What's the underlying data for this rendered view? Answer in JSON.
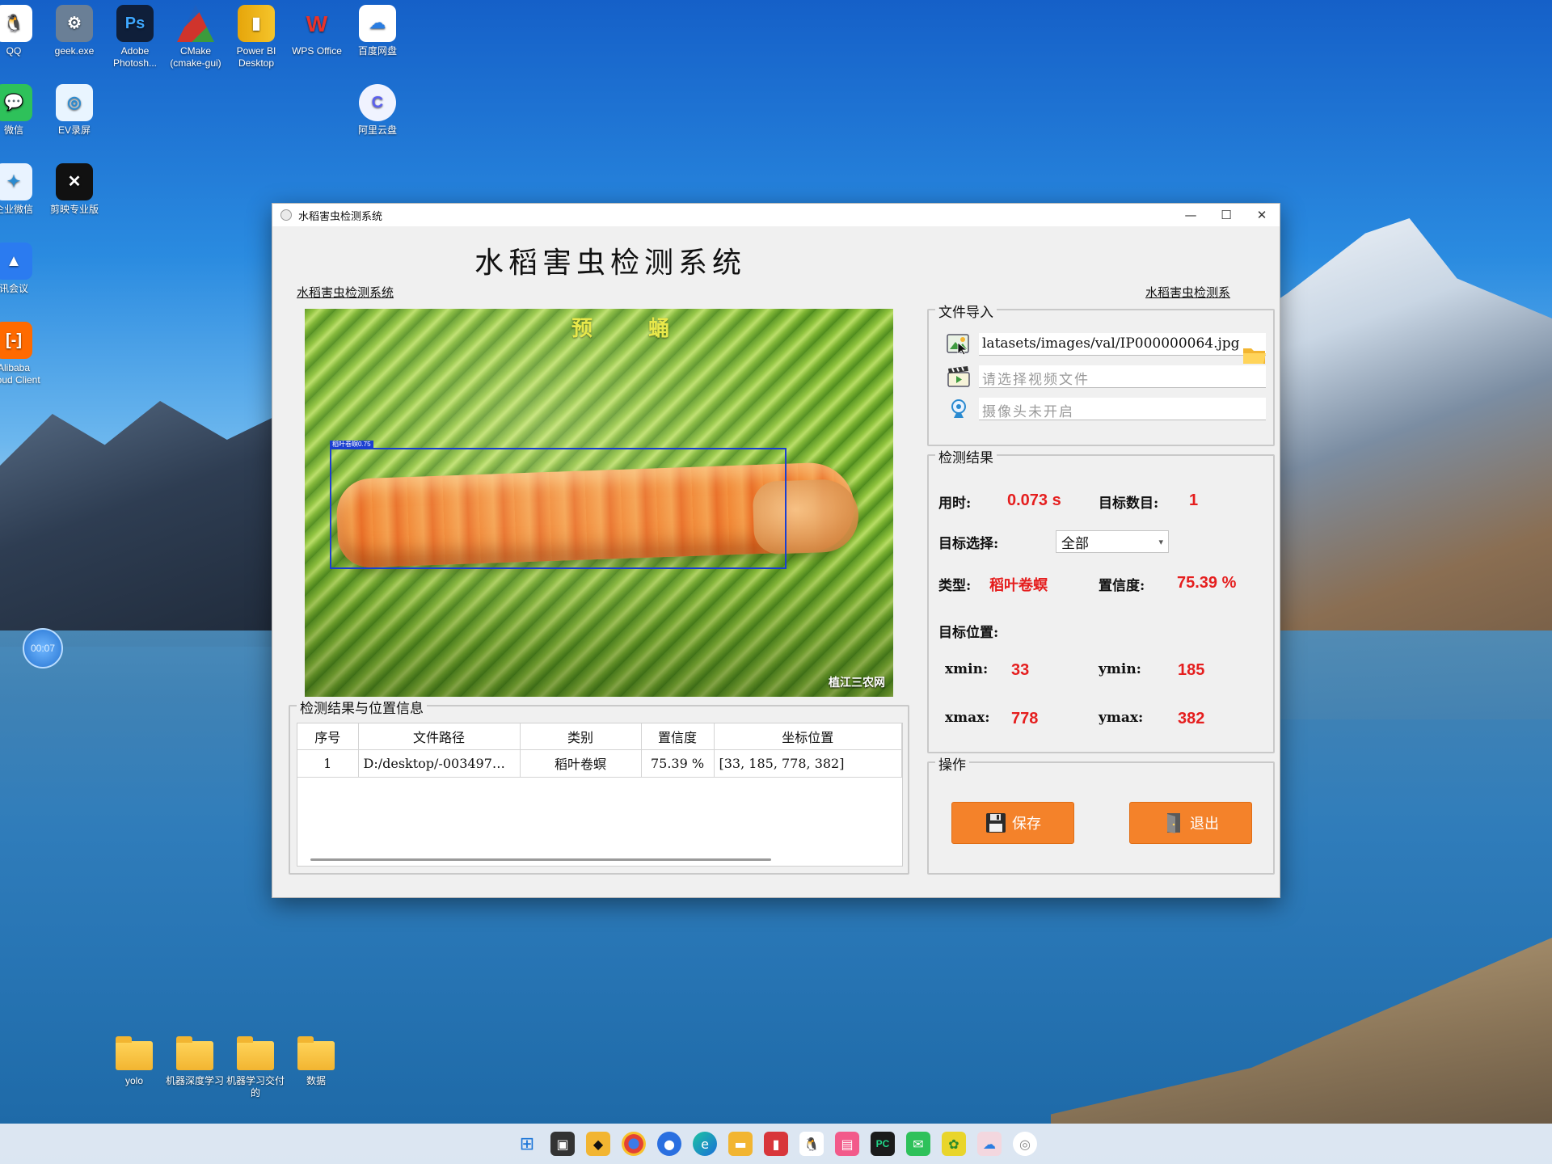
{
  "desktop": {
    "icons": [
      {
        "label": "QQ"
      },
      {
        "label": "geek.exe"
      },
      {
        "label": "Adobe Photosh..."
      },
      {
        "label": "CMake (cmake-gui)"
      },
      {
        "label": "Power BI Desktop"
      },
      {
        "label": "WPS Office"
      },
      {
        "label": "百度网盘"
      },
      {
        "label": "微信"
      },
      {
        "label": "EV录屏"
      },
      {
        "label": "阿里云盘"
      },
      {
        "label": "企业微信"
      },
      {
        "label": "剪映专业版"
      },
      {
        "label": "讯会议"
      },
      {
        "label": "Alibaba Cloud Client"
      }
    ],
    "folders": [
      {
        "label": "yolo"
      },
      {
        "label": "机器深度学习"
      },
      {
        "label": "机器学习交付的"
      },
      {
        "label": "数据"
      }
    ],
    "timer": "00:07"
  },
  "window": {
    "title": "水稻害虫检测系统",
    "controls": {
      "minimize": "—",
      "maximize": "☐",
      "close": "✕"
    }
  },
  "app": {
    "main_title": "水稻害虫检测系统",
    "link_left": "水稻害虫检测系统",
    "link_right": "水稻害虫检测系",
    "image": {
      "caption": "预 蛹",
      "bbox_label": "稻叶卷螟0.75",
      "watermark": "植江三农网"
    },
    "file_import": {
      "title": "文件导入",
      "image_path": "latasets/images/val/IP000000064.jpg",
      "video_placeholder": "请选择视频文件",
      "camera_placeholder": "摄像头未开启"
    },
    "results": {
      "title": "检测结果",
      "time_label": "用时:",
      "time_value": "0.073 s",
      "count_label": "目标数目:",
      "count_value": "1",
      "target_select_label": "目标选择:",
      "target_select_value": "全部",
      "type_label": "类型:",
      "type_value": "稻叶卷螟",
      "conf_label": "置信度:",
      "conf_value": "75.39 %",
      "position_label": "目标位置:",
      "xmin_label": "xmin:",
      "xmin_value": "33",
      "ymin_label": "ymin:",
      "ymin_value": "185",
      "xmax_label": "xmax:",
      "xmax_value": "778",
      "ymax_label": "ymax:",
      "ymax_value": "382"
    },
    "operations": {
      "title": "操作",
      "save_label": "保存",
      "exit_label": "退出"
    },
    "table": {
      "title": "检测结果与位置信息",
      "headers": [
        "序号",
        "文件路径",
        "类别",
        "置信度",
        "坐标位置"
      ],
      "rows": [
        [
          "1",
          "D:/desktop/-003497…",
          "稻叶卷螟",
          "75.39 %",
          "[33, 185, 778, 382]"
        ]
      ]
    }
  },
  "colors": {
    "accent_red": "#e51e1e",
    "button_orange": "#f4822a",
    "bbox_blue": "#1b3fd0"
  }
}
